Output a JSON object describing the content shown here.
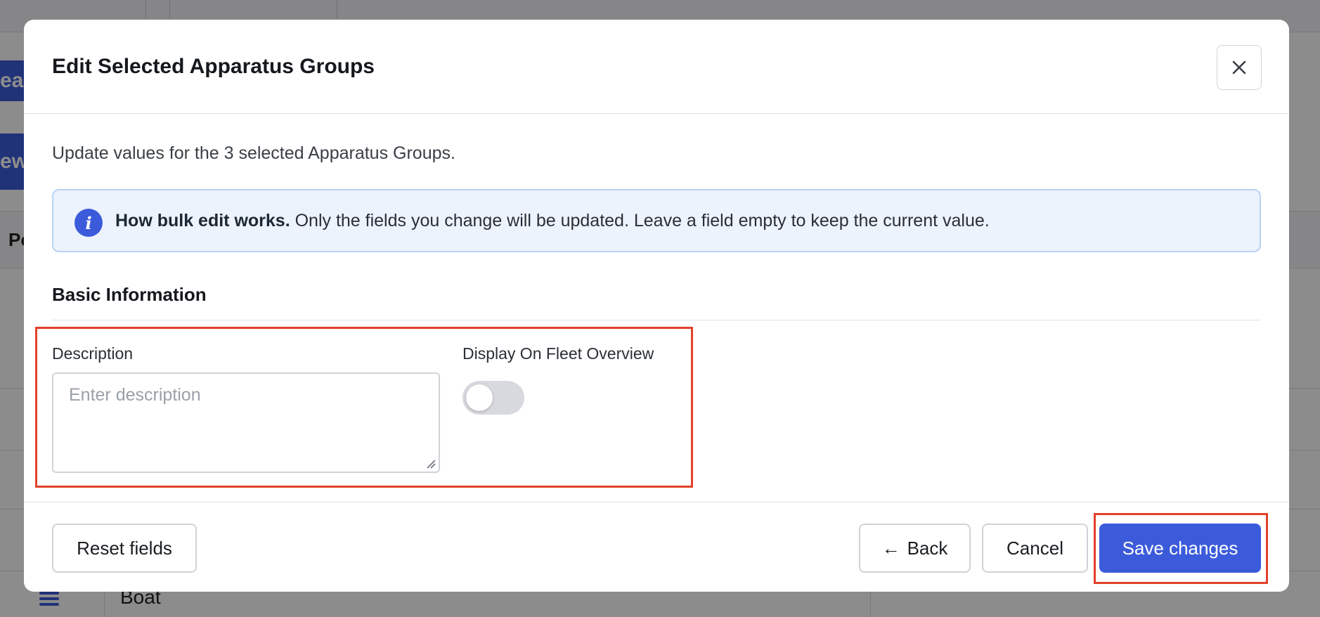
{
  "background": {
    "button_one_text": "ear",
    "button_two_text": "ew",
    "section_label": "Po",
    "bottom_row_name": "Boat"
  },
  "modal": {
    "title": "Edit Selected Apparatus Groups",
    "intro": "Update values for the 3 selected Apparatus Groups.",
    "info": {
      "icon": "info-icon",
      "heading": "How bulk edit works.",
      "text": " Only the fields you change will be updated. Leave a field empty to keep the current value."
    },
    "section_title": "Basic Information",
    "fields": {
      "description": {
        "label": "Description",
        "placeholder": "Enter description",
        "value": ""
      },
      "display_on_fleet_overview": {
        "label": "Display On Fleet Overview",
        "checked": false
      }
    },
    "footer": {
      "reset_label": "Reset fields",
      "back_arrow": "←",
      "back_label": "Back",
      "cancel_label": "Cancel",
      "save_label": "Save changes"
    }
  },
  "colors": {
    "accent": "#3b5bdb",
    "highlight": "#e2412b",
    "info_bg": "#edf3fd"
  }
}
